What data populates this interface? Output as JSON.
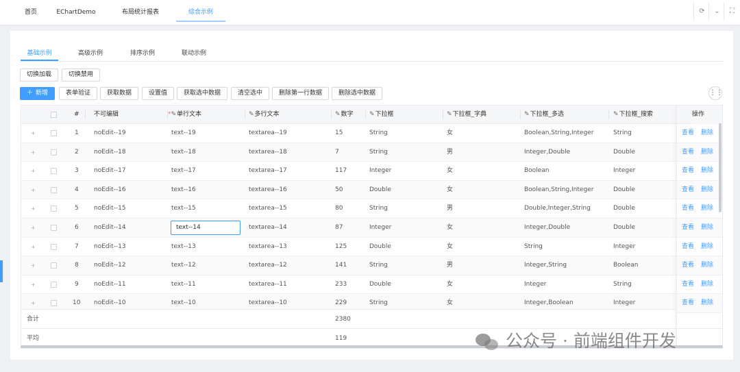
{
  "top_tabs": [
    "首页",
    "EChartDemo",
    "布局统计报表",
    "综合示例"
  ],
  "top_controls": [
    "⟳",
    "⌄",
    "⛶"
  ],
  "sub_tabs": [
    "基础示例",
    "高级示例",
    "排序示例",
    "联动示例"
  ],
  "toolbar1": [
    "切换加载",
    "切换禁用"
  ],
  "toolbar2": {
    "new_label": "新增",
    "buttons": [
      "表单验证",
      "获取数据",
      "设置值",
      "获取选中数据",
      "清空选中",
      "删除第一行数据",
      "删除选中数据"
    ]
  },
  "grid_icon": "grid-settings-icon",
  "table": {
    "headers": {
      "index": "#",
      "noedit": "不可编辑",
      "single": "单行文本",
      "multi": "多行文本",
      "number": "数字",
      "select": "下拉框",
      "dict": "下拉框_字典",
      "multiselect": "下拉框_多选",
      "search": "下拉框_搜索",
      "ops": "操作"
    },
    "edit_icon": "✎",
    "required_mark": "*",
    "rows": [
      {
        "idx": "1",
        "noedit": "noEdit--19",
        "single": "text--19",
        "multi": "textarea--19",
        "num": "15",
        "select": "String",
        "dict": "女",
        "ms": "Boolean,String,Integer",
        "search": "String"
      },
      {
        "idx": "2",
        "noedit": "noEdit--18",
        "single": "text--18",
        "multi": "textarea--18",
        "num": "7",
        "select": "String",
        "dict": "男",
        "ms": "Integer,Double",
        "search": "Double"
      },
      {
        "idx": "3",
        "noedit": "noEdit--17",
        "single": "text--17",
        "multi": "textarea--17",
        "num": "117",
        "select": "Integer",
        "dict": "女",
        "ms": "Boolean",
        "search": "Integer"
      },
      {
        "idx": "4",
        "noedit": "noEdit--16",
        "single": "text--16",
        "multi": "textarea--16",
        "num": "50",
        "select": "Double",
        "dict": "女",
        "ms": "Boolean,String,Integer",
        "search": "Double"
      },
      {
        "idx": "5",
        "noedit": "noEdit--15",
        "single": "text--15",
        "multi": "textarea--15",
        "num": "80",
        "select": "String",
        "dict": "男",
        "ms": "Double,Integer,String",
        "search": "Double"
      },
      {
        "idx": "6",
        "noedit": "noEdit--14",
        "single": "text--14",
        "multi": "textarea--14",
        "num": "87",
        "select": "Integer",
        "dict": "女",
        "ms": "Integer,Double",
        "search": "Double"
      },
      {
        "idx": "7",
        "noedit": "noEdit--13",
        "single": "text--13",
        "multi": "textarea--13",
        "num": "125",
        "select": "Double",
        "dict": "女",
        "ms": "String",
        "search": "Integer"
      },
      {
        "idx": "8",
        "noedit": "noEdit--12",
        "single": "text--12",
        "multi": "textarea--12",
        "num": "141",
        "select": "String",
        "dict": "男",
        "ms": "Integer,String",
        "search": "Boolean"
      },
      {
        "idx": "9",
        "noedit": "noEdit--11",
        "single": "text--11",
        "multi": "textarea--11",
        "num": "233",
        "select": "Double",
        "dict": "女",
        "ms": "Integer",
        "search": "String"
      },
      {
        "idx": "10",
        "noedit": "noEdit--10",
        "single": "text--10",
        "multi": "textarea--10",
        "num": "229",
        "select": "String",
        "dict": "女",
        "ms": "Integer,Boolean",
        "search": "Integer"
      }
    ],
    "row_actions": {
      "view": "查看",
      "delete": "删除"
    },
    "expand_symbol": "+",
    "footer": {
      "sum_label": "合计",
      "sum_value": "2380",
      "avg_label": "平均",
      "avg_value": "119"
    }
  },
  "watermark": "公众号 · 前端组件开发"
}
